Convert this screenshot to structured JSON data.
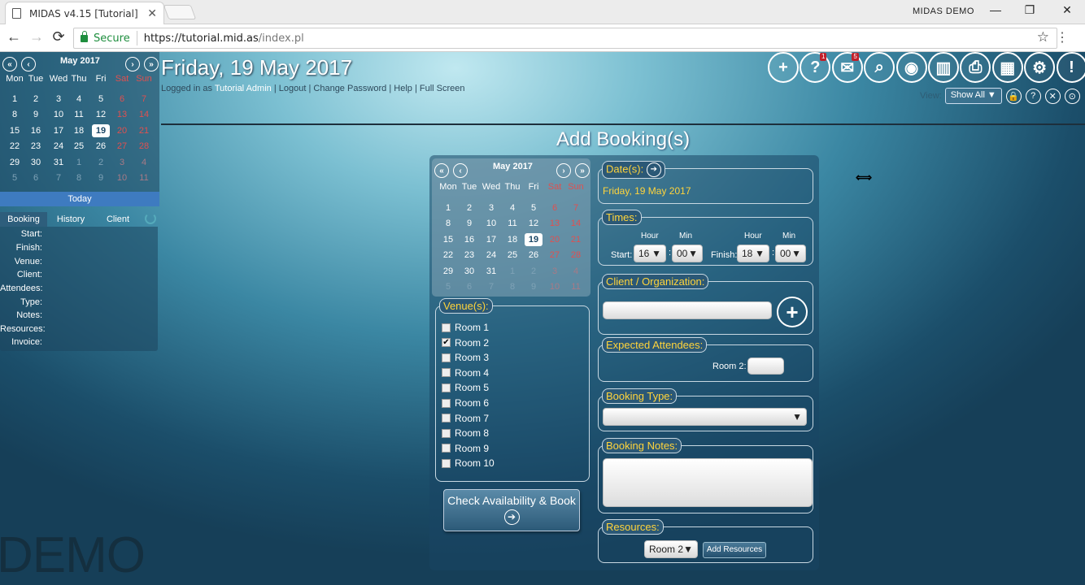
{
  "browser": {
    "tab_title": "MIDAS v4.15 [Tutorial]",
    "tab_close": "✕",
    "window_label": "MIDAS DEMO",
    "min": "—",
    "restore": "❐",
    "close": "✕",
    "back": "←",
    "forward": "→",
    "reload": "⟳",
    "secure": "Secure",
    "url_host": "https://tutorial.mid.as",
    "url_path": "/index.pl",
    "star": "☆",
    "menu": "⋮"
  },
  "header": {
    "date": "Friday, 19 May 2017",
    "logged_in": "Logged in as ",
    "user": "Tutorial Admin",
    "logout": "Logout",
    "change_password": "Change Password",
    "help": "Help",
    "full_screen": "Full Screen",
    "sep": " | ",
    "toolbar_icons": [
      "add-icon",
      "help-icon",
      "mail-icon",
      "search-icon",
      "view-icon",
      "stats-icon",
      "print-icon",
      "calculator-icon",
      "settings-icon",
      "warning-icon"
    ],
    "toolbar_glyphs": [
      "+",
      "?",
      "✉",
      "⌕",
      "◉",
      "▥",
      "⎙",
      "▦",
      "⚙",
      "!"
    ],
    "help_badge": "1",
    "mail_badge": "5",
    "view_label": "View:",
    "view_value": "Show All",
    "view_arrow": "▼",
    "small_icons": [
      "🔒",
      "?",
      "✕",
      "⊙"
    ]
  },
  "mini_calendar": {
    "month": "May 2017",
    "nav": [
      "«",
      "‹",
      "›",
      "»"
    ],
    "days_of_week": [
      "Mon",
      "Tue",
      "Wed",
      "Thu",
      "Fri",
      "Sat",
      "Sun"
    ],
    "weeks": [
      [
        "1",
        "2",
        "3",
        "4",
        "5",
        "6",
        "7"
      ],
      [
        "8",
        "9",
        "10",
        "11",
        "12",
        "13",
        "14"
      ],
      [
        "15",
        "16",
        "17",
        "18",
        "19",
        "20",
        "21"
      ],
      [
        "22",
        "23",
        "24",
        "25",
        "26",
        "27",
        "28"
      ],
      [
        "29",
        "30",
        "31",
        "1",
        "2",
        "3",
        "4"
      ],
      [
        "5",
        "6",
        "7",
        "8",
        "9",
        "10",
        "11"
      ]
    ],
    "today_button": "Today"
  },
  "left_tabs": [
    "Booking",
    "History",
    "Client"
  ],
  "info_labels": [
    "Start:",
    "Finish:",
    "Venue:",
    "Client:",
    "Attendees:",
    "Type:",
    "Notes:",
    "Resources:",
    "Invoice:"
  ],
  "watermark": "DEMO",
  "form": {
    "title": "Add Booking(s)",
    "calendar_month": "May 2017",
    "dates_legend": "Date(s):",
    "selected_date": "Friday, 19 May 2017",
    "times_legend": "Times:",
    "hour_label": "Hour",
    "min_label": "Min",
    "start_label": "Start:",
    "finish_label": "Finish:",
    "start_hour": "16",
    "start_min": "00",
    "finish_hour": "18",
    "finish_min": "00",
    "colon": ":",
    "arrow": "▼",
    "client_legend": "Client / Organization:",
    "client_value": "",
    "add_glyph": "+",
    "venues_legend": "Venue(s):",
    "venues": [
      "Room 1",
      "Room 2",
      "Room 3",
      "Room 4",
      "Room 5",
      "Room 6",
      "Room 7",
      "Room 8",
      "Room 9",
      "Room 10"
    ],
    "checked_mark": "✔",
    "attendees_legend": "Expected Attendees:",
    "attendees_room_label": "Room 2:",
    "attendees_value": "",
    "type_legend": "Booking Type:",
    "type_value": "",
    "notes_legend": "Booking Notes:",
    "notes_value": "",
    "resources_legend": "Resources:",
    "resources_room": "Room 2",
    "add_resources": "Add Resources",
    "check_button": "Check Availability & Book",
    "go_glyph": "➔"
  }
}
